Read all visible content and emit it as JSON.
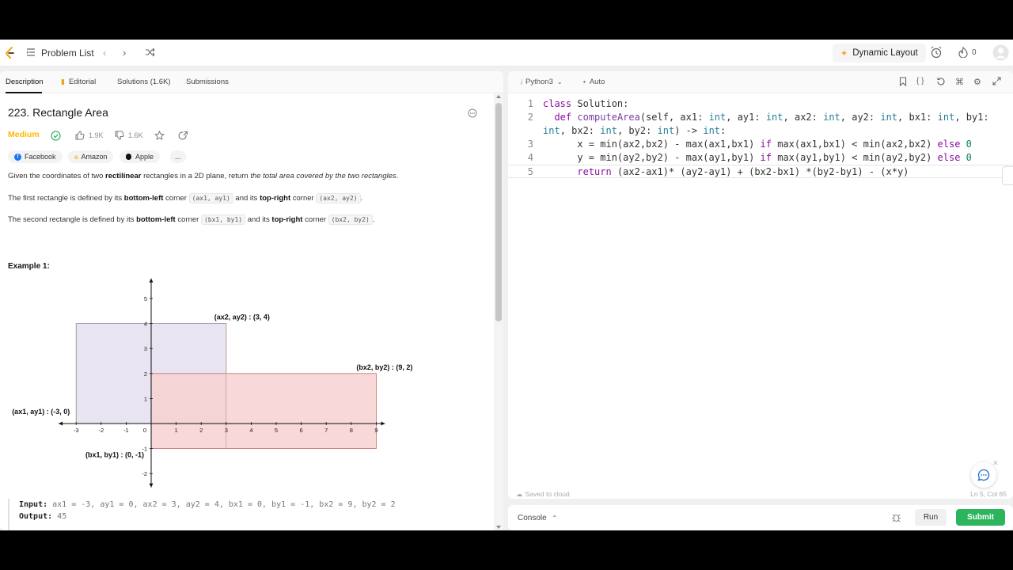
{
  "nav": {
    "problem_list": "Problem List",
    "dynamic_layout": "Dynamic Layout",
    "streak_count": "0"
  },
  "tabs": [
    "Description",
    "Editorial",
    "Solutions (1.6K)",
    "Submissions"
  ],
  "problem": {
    "title": "223. Rectangle Area",
    "difficulty": "Medium",
    "likes": "1.9K",
    "dislikes": "1.6K",
    "companies": [
      "Facebook",
      "Amazon",
      "Apple"
    ],
    "more_companies": "...",
    "p1_a": "Given the coordinates of two ",
    "p1_b": "rectilinear",
    "p1_c": " rectangles in a 2D plane, return ",
    "p1_d": "the total area covered by the two rectangles",
    "p1_e": ".",
    "p2_a": "The first rectangle is defined by its ",
    "p2_b": "bottom-left",
    "p2_c": " corner ",
    "p2_d": "(ax1, ay1)",
    "p2_e": " and its ",
    "p2_f": "top-right",
    "p2_g": " corner ",
    "p2_h": "(ax2, ay2)",
    "p2_i": ".",
    "p3_a": "The second rectangle is defined by its ",
    "p3_b": "bottom-left",
    "p3_c": " corner ",
    "p3_d": "(bx1, by1)",
    "p3_e": " and its ",
    "p3_f": "top-right",
    "p3_g": " corner ",
    "p3_h": "(bx2, by2)",
    "p3_i": ".",
    "example_title": "Example 1:",
    "input_label": "Input:",
    "input_value": " ax1 = -3, ay1 = 0, ax2 = 3, ay2 = 4, bx1 = 0, by1 = -1, bx2 = 9, by2 = 2",
    "output_label": "Output:",
    "output_value": " 45"
  },
  "chart_data": {
    "type": "diagram",
    "xlim": [
      -3,
      9
    ],
    "ylim": [
      -2,
      5
    ],
    "x_ticks": [
      "-3",
      "-2",
      "-1",
      "0",
      "1",
      "2",
      "3",
      "4",
      "5",
      "6",
      "7",
      "8",
      "9"
    ],
    "y_ticks": [
      "5",
      "4",
      "3",
      "2",
      "1",
      "-1",
      "-2"
    ],
    "rect_a": {
      "x1": -3,
      "y1": 0,
      "x2": 3,
      "y2": 4,
      "color": "#e9e4f1"
    },
    "rect_b": {
      "x1": 0,
      "y1": -1,
      "x2": 9,
      "y2": 2,
      "color": "#f7d1d1"
    },
    "labels": {
      "a_top": "(ax2, ay2) : (3, 4)",
      "b_top": "(bx2, by2) : (9, 2)",
      "a_bottom": "(ax1, ay1) : (-3, 0)",
      "b_bottom": "(bx1, by1) : (0, -1)"
    }
  },
  "editor": {
    "language": "Python3",
    "mode": "Auto",
    "lines": [
      {
        "n": "1",
        "t": "class Solution:"
      },
      {
        "n": "2",
        "t": "  def computeArea(self, ax1: int, ay1: int, ax2: int, ay2: int, bx1: int, by1:"
      },
      {
        "n": "",
        "t": "int, bx2: int, by2: int) -> int:"
      },
      {
        "n": "3",
        "t": "      x = min(ax2,bx2) - max(ax1,bx1) if max(ax1,bx1) < min(ax2,bx2) else 0"
      },
      {
        "n": "4",
        "t": "      y = min(ay2,by2) - max(ay1,by1) if max(ay1,by1) < min(ay2,by2) else 0"
      },
      {
        "n": "5",
        "t": "      return (ax2-ax1)* (ay2-ay1) + (bx2-bx1) *(by2-by1) - (x*y)"
      }
    ],
    "saved": "Saved to cloud",
    "position": "Ln 5, Col 65"
  },
  "console": {
    "label": "Console",
    "run": "Run",
    "submit": "Submit"
  }
}
